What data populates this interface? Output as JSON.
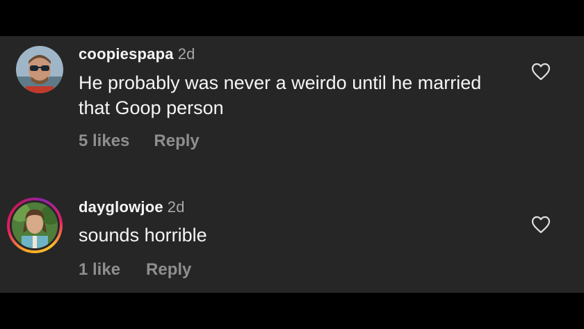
{
  "comments": [
    {
      "username": "coopiespapa",
      "timestamp": "2d",
      "text": "He probably was never a weirdo until he married that Goop person",
      "likes": "5 likes",
      "reply_label": "Reply",
      "avatar_icon": "user-avatar-sunglasses",
      "has_story_ring": false
    },
    {
      "username": "dayglowjoe",
      "timestamp": "2d",
      "text": "sounds horrible",
      "likes": "1 like",
      "reply_label": "Reply",
      "avatar_icon": "user-avatar-outdoors",
      "has_story_ring": true
    }
  ],
  "like_icon": "heart-outline-icon",
  "colors": {
    "background": "#262626",
    "letterbox": "#000000",
    "primary_text": "#f5f5f5",
    "secondary_text": "#8e8e8e",
    "story_ring_start": "#f9a825",
    "story_ring_end": "#c2185b"
  }
}
